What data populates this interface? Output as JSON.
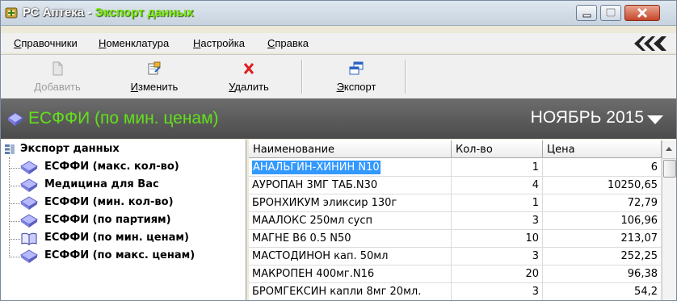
{
  "window": {
    "app_name": "РС Аптека",
    "separator": " - ",
    "doc_name": "Экспорт данных",
    "buttons": [
      "minimize-button",
      "maximize-button",
      "close-button"
    ]
  },
  "menu": [
    {
      "u": "С",
      "rest": "правочники"
    },
    {
      "u": "Н",
      "rest": "оменклатура"
    },
    {
      "u": "Н",
      "rest": "астройка"
    },
    {
      "u": "С",
      "rest": "правка"
    }
  ],
  "toolbar": {
    "add": {
      "u": "Д",
      "rest": "обавить",
      "icon": "document-add-icon",
      "disabled": true
    },
    "edit": {
      "u": "И",
      "rest": "зменить",
      "icon": "edit-document-icon",
      "disabled": false
    },
    "delete": {
      "u": "У",
      "rest": "далить",
      "icon": "red-x-icon",
      "disabled": false
    },
    "export": {
      "u": "Э",
      "rest": "кспорт",
      "icon": "export-windows-icon",
      "disabled": false
    }
  },
  "section": {
    "title": "ЕСФФИ (по мин. ценам)",
    "period": "НОЯБРЬ 2015",
    "icon": "diamond-icon",
    "title_color": "#62e01a"
  },
  "tree": {
    "root": "Экспорт данных",
    "items": [
      {
        "label": "ЕСФФИ (макс. кол-во)",
        "icon": "diamond-icon"
      },
      {
        "label": "Медицина для Вас",
        "icon": "diamond-icon"
      },
      {
        "label": "ЕСФФИ (мин. кол-во)",
        "icon": "diamond-icon"
      },
      {
        "label": "ЕСФФИ (по партиям)",
        "icon": "diamond-icon"
      },
      {
        "label": "ЕСФФИ (по мин. ценам)",
        "icon": "open-book-icon",
        "selected": true
      },
      {
        "label": "ЕСФФИ (по макс. ценам)",
        "icon": "diamond-icon"
      }
    ]
  },
  "grid": {
    "headers": [
      "Наименование",
      "Кол-во",
      "Цена"
    ],
    "rows": [
      {
        "name": "АНАЛЬГИН-ХИНИН N10",
        "qty": "1",
        "price": "6",
        "selected": true
      },
      {
        "name": "АУРОПАН 3МГ ТАБ.N30",
        "qty": "4",
        "price": "10250,65"
      },
      {
        "name": "БРОНХИКУМ эликсир 130г",
        "qty": "1",
        "price": "72,79"
      },
      {
        "name": "МААЛОКС 250мл сусп",
        "qty": "3",
        "price": "106,96"
      },
      {
        "name": "МАГНЕ В6 0.5 N50",
        "qty": "10",
        "price": "213,07"
      },
      {
        "name": "МАСТОДИНОН кап. 50мл",
        "qty": "3",
        "price": "252,25"
      },
      {
        "name": "МАКРОПЕН 400мг.N16",
        "qty": "20",
        "price": "96,38"
      },
      {
        "name": "БРОМГЕКСИН капли 8мг 20мл.",
        "qty": "3",
        "price": "54,2"
      }
    ]
  }
}
